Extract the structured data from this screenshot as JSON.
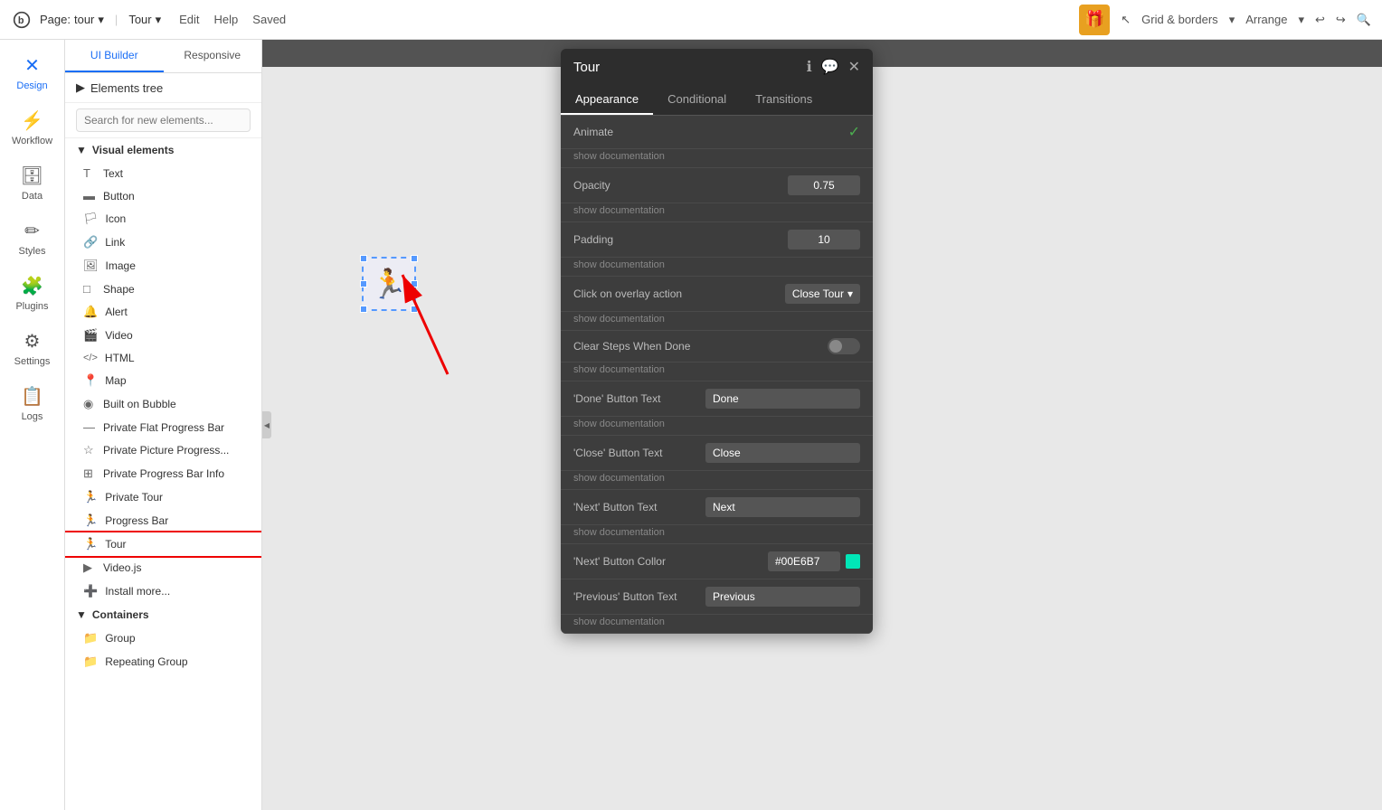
{
  "topbar": {
    "logo_text": "b",
    "page_label": "Page:",
    "page_name": "tour",
    "separator": "|",
    "page_name2": "Tour",
    "edit": "Edit",
    "help": "Help",
    "saved": "Saved",
    "grid_borders": "Grid & borders",
    "arrange": "Arrange",
    "undo_icon": "↩",
    "redo_icon": "↪",
    "search_icon": "🔍"
  },
  "sidebar": {
    "items": [
      {
        "id": "design",
        "label": "Design",
        "icon": "✕"
      },
      {
        "id": "workflow",
        "label": "Workflow",
        "icon": "⚡"
      },
      {
        "id": "data",
        "label": "Data",
        "icon": "🗄"
      },
      {
        "id": "styles",
        "label": "Styles",
        "icon": "✏"
      },
      {
        "id": "plugins",
        "label": "Plugins",
        "icon": "🧩"
      },
      {
        "id": "settings",
        "label": "Settings",
        "icon": "⚙"
      },
      {
        "id": "logs",
        "label": "Logs",
        "icon": "📋"
      }
    ]
  },
  "panel": {
    "tab_ui_builder": "UI Builder",
    "tab_responsive": "Responsive",
    "elements_tree_label": "Elements tree",
    "search_placeholder": "Search for new elements...",
    "section_visual": "Visual elements",
    "elements": [
      {
        "id": "text",
        "label": "Text",
        "icon": "T"
      },
      {
        "id": "button",
        "label": "Button",
        "icon": "▬"
      },
      {
        "id": "icon",
        "label": "Icon",
        "icon": "🏳"
      },
      {
        "id": "link",
        "label": "Link",
        "icon": "🔗"
      },
      {
        "id": "image",
        "label": "Image",
        "icon": "🖼"
      },
      {
        "id": "shape",
        "label": "Shape",
        "icon": "□"
      },
      {
        "id": "alert",
        "label": "Alert",
        "icon": "🔔"
      },
      {
        "id": "video",
        "label": "Video",
        "icon": "🎬"
      },
      {
        "id": "html",
        "label": "HTML",
        "icon": "</>"
      },
      {
        "id": "map",
        "label": "Map",
        "icon": "📍"
      },
      {
        "id": "built-on-bubble",
        "label": "Built on Bubble",
        "icon": "◉"
      },
      {
        "id": "private-flat-progress",
        "label": "Private Flat Progress Bar",
        "icon": "—"
      },
      {
        "id": "private-picture-progress",
        "label": "Private Picture Progress...",
        "icon": "☆"
      },
      {
        "id": "private-progress-bar-info",
        "label": "Private Progress Bar Info",
        "icon": "⚙"
      },
      {
        "id": "private-tour",
        "label": "Private Tour",
        "icon": "🏃"
      },
      {
        "id": "progress-bar",
        "label": "Progress Bar",
        "icon": "🏃"
      },
      {
        "id": "tour",
        "label": "Tour",
        "icon": "🏃",
        "selected": true
      },
      {
        "id": "videojs",
        "label": "Video.js",
        "icon": "▶"
      },
      {
        "id": "install-more",
        "label": "Install more...",
        "icon": "➕"
      }
    ],
    "section_containers": "Containers",
    "containers": [
      {
        "id": "group",
        "label": "Group",
        "icon": "📁"
      },
      {
        "id": "repeating-group",
        "label": "Repeating Group",
        "icon": "📁"
      }
    ]
  },
  "properties": {
    "title": "Tour",
    "info_icon": "ℹ",
    "comment_icon": "💬",
    "close_icon": "✕",
    "tabs": [
      "Appearance",
      "Conditional",
      "Transitions"
    ],
    "active_tab": "Appearance",
    "fields": [
      {
        "label": "Animate",
        "type": "check",
        "value": "✓",
        "doc": "show documentation"
      },
      {
        "label": "Opacity",
        "type": "number",
        "value": "0.75",
        "doc": "show documentation"
      },
      {
        "label": "Padding",
        "type": "number",
        "value": "10",
        "doc": "show documentation"
      },
      {
        "label": "Click on overlay action",
        "type": "dropdown",
        "value": "Close Tour",
        "doc": "show documentation"
      },
      {
        "label": "Clear Steps When Done",
        "type": "toggle",
        "value": "off",
        "doc": "show documentation"
      },
      {
        "label": "'Done' Button Text",
        "type": "text",
        "value": "Done",
        "doc": "show documentation"
      },
      {
        "label": "'Close' Button Text",
        "type": "text",
        "value": "Close",
        "doc": "show documentation"
      },
      {
        "label": "'Next' Button Text",
        "type": "text",
        "value": "Next",
        "doc": "show documentation"
      },
      {
        "label": "'Next' Button Collor",
        "type": "color",
        "value": "#00E6B7",
        "doc": ""
      },
      {
        "label": "'Previous' Button Text",
        "type": "text",
        "value": "Previous",
        "doc": "show documentation"
      }
    ]
  }
}
